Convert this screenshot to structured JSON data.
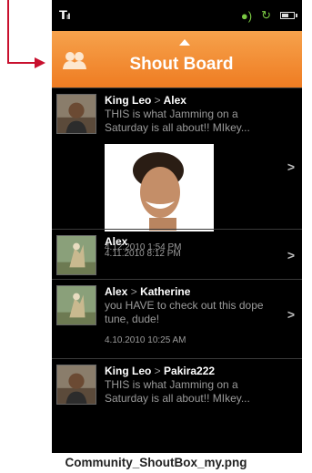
{
  "header": {
    "title": "Shout Board"
  },
  "colors": {
    "header_top": "#f6a24c",
    "header_bottom": "#ef7c22",
    "callout": "#c8102e",
    "status_green": "#7ac943"
  },
  "status_icons": [
    "signal-icon",
    "speaker-icon",
    "sync-icon",
    "battery-icon"
  ],
  "shouts": [
    {
      "from": "King Leo",
      "separator": ">",
      "to": "Alex",
      "message": "THIS is what Jamming on a Saturday is all about!! MIkey...",
      "timestamp": "4.12.2010 1:54 PM"
    },
    {
      "from": "Alex",
      "timestamp": "4.11.2010 8:12 PM"
    },
    {
      "from": "Alex",
      "separator": ">",
      "to": "Katherine",
      "message": "you HAVE to check out this dope tune, dude!",
      "timestamp": "4.10.2010 10:25 AM"
    },
    {
      "from": "King Leo",
      "separator": ">",
      "to": "Pakira222",
      "message": "THIS is what Jamming on a Saturday is all about!! MIkey..."
    }
  ],
  "caption": "Community_ShoutBox_my.png"
}
